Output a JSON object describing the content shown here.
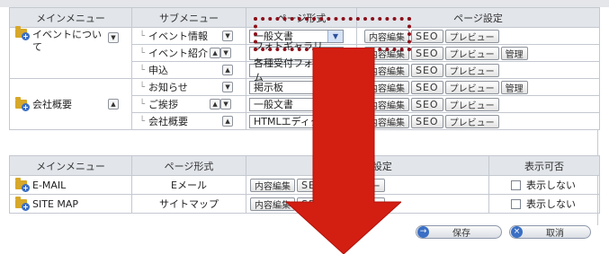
{
  "menu_table": {
    "headers": [
      "メインメニュー",
      "サブメニュー",
      "ページ形式",
      "ページ設定"
    ],
    "groups": [
      {
        "main": "イベントについて",
        "rows": [
          {
            "sub": "イベント情報",
            "arrows": "down",
            "format": "一般文書",
            "buttons": [
              "内容編集",
              "SEO",
              "プレビュー"
            ],
            "manage": ""
          },
          {
            "sub": "イベント紹介",
            "arrows": "updown",
            "format": "フォトギャラリー",
            "buttons": [
              "内容編集",
              "SEO",
              "プレビュー"
            ],
            "manage": "管理"
          },
          {
            "sub": "申込",
            "arrows": "up",
            "format": "各種受付フォーム",
            "buttons": [
              "内容編集",
              "SEO",
              "プレビュー"
            ],
            "manage": ""
          }
        ]
      },
      {
        "main": "会社概要",
        "rows": [
          {
            "sub": "お知らせ",
            "arrows": "down",
            "format": "掲示板",
            "buttons": [
              "内容編集",
              "SEO",
              "プレビュー"
            ],
            "manage": "管理"
          },
          {
            "sub": "ご挨拶",
            "arrows": "updown",
            "format": "一般文書",
            "buttons": [
              "内容編集",
              "SEO",
              "プレビュー"
            ],
            "manage": ""
          },
          {
            "sub": "会社概要",
            "arrows": "up",
            "format": "HTMLエディタ",
            "buttons": [
              "内容編集",
              "SEO",
              "プレビュー"
            ],
            "manage": ""
          }
        ]
      }
    ]
  },
  "system_table": {
    "headers": [
      "メインメニュー",
      "ページ形式",
      "ページ設定",
      "表示可否"
    ],
    "rows": [
      {
        "main": "E-MAIL",
        "format": "Eメール",
        "buttons": [
          "内容編集",
          "SEO",
          "プレビュー"
        ],
        "visibility": "表示しない"
      },
      {
        "main": "SITE MAP",
        "format": "サイトマップ",
        "buttons": [
          "内容編集",
          "SEO",
          "プレビュー"
        ],
        "visibility": "表示しない"
      }
    ]
  },
  "actions": {
    "save": "保存",
    "cancel": "取消"
  },
  "colors": {
    "highlight_border": "#8b0f1a",
    "arrow": "#d31e12",
    "header_bg": "#e2e5ea"
  }
}
